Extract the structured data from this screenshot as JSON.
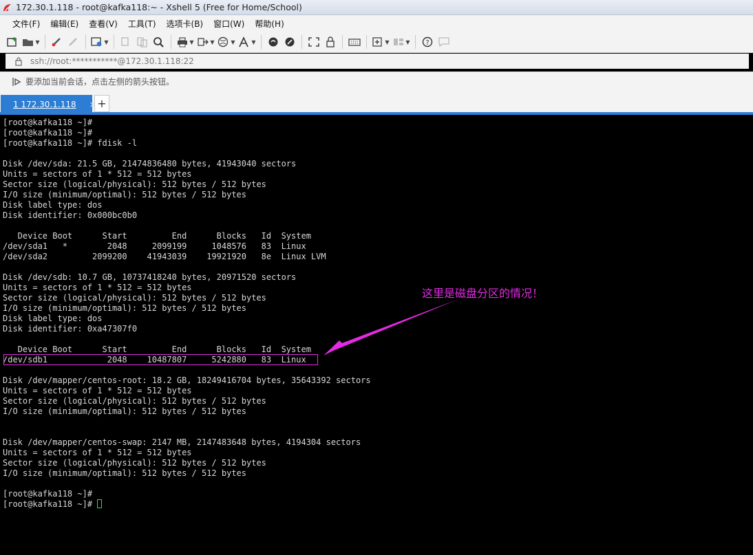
{
  "window": {
    "title": "172.30.1.118 - root@kafka118:~ - Xshell 5 (Free for Home/School)"
  },
  "menu": {
    "items": [
      "文件(F)",
      "编辑(E)",
      "查看(V)",
      "工具(T)",
      "选项卡(B)",
      "窗口(W)",
      "帮助(H)"
    ]
  },
  "toolbar": {
    "icons": [
      "new-session",
      "open-folder",
      "connect",
      "disconnect",
      "properties",
      "copy",
      "paste",
      "find",
      "print",
      "transfer",
      "globe",
      "font",
      "xftp",
      "xshell",
      "fullscreen",
      "lock",
      "keyboard",
      "add",
      "layout",
      "help",
      "chat"
    ]
  },
  "address": {
    "text": "ssh://root:***********@172.30.1.118:22"
  },
  "hint": {
    "text": "要添加当前会话，点击左侧的箭头按钮。"
  },
  "tabs": [
    {
      "label": "1 172.30.1.118",
      "close": "×"
    }
  ],
  "new_tab": "+",
  "terminal": {
    "lines": [
      "[root@kafka118 ~]#",
      "[root@kafka118 ~]#",
      "[root@kafka118 ~]# fdisk -l",
      "",
      "Disk /dev/sda: 21.5 GB, 21474836480 bytes, 41943040 sectors",
      "Units = sectors of 1 * 512 = 512 bytes",
      "Sector size (logical/physical): 512 bytes / 512 bytes",
      "I/O size (minimum/optimal): 512 bytes / 512 bytes",
      "Disk label type: dos",
      "Disk identifier: 0x000bc0b0",
      "",
      "   Device Boot      Start         End      Blocks   Id  System",
      "/dev/sda1   *        2048     2099199     1048576   83  Linux",
      "/dev/sda2         2099200    41943039    19921920   8e  Linux LVM",
      "",
      "Disk /dev/sdb: 10.7 GB, 10737418240 bytes, 20971520 sectors",
      "Units = sectors of 1 * 512 = 512 bytes",
      "Sector size (logical/physical): 512 bytes / 512 bytes",
      "I/O size (minimum/optimal): 512 bytes / 512 bytes",
      "Disk label type: dos",
      "Disk identifier: 0xa47307f0",
      "",
      "   Device Boot      Start         End      Blocks   Id  System",
      "/dev/sdb1            2048    10487807     5242880   83  Linux",
      "",
      "Disk /dev/mapper/centos-root: 18.2 GB, 18249416704 bytes, 35643392 sectors",
      "Units = sectors of 1 * 512 = 512 bytes",
      "Sector size (logical/physical): 512 bytes / 512 bytes",
      "I/O size (minimum/optimal): 512 bytes / 512 bytes",
      "",
      "",
      "Disk /dev/mapper/centos-swap: 2147 MB, 2147483648 bytes, 4194304 sectors",
      "Units = sectors of 1 * 512 = 512 bytes",
      "Sector size (logical/physical): 512 bytes / 512 bytes",
      "I/O size (minimum/optimal): 512 bytes / 512 bytes",
      "",
      "[root@kafka118 ~]#",
      "[root@kafka118 ~]# "
    ]
  },
  "annotation": {
    "text": "这里是磁盘分区的情况！",
    "color": "#e42be4"
  },
  "colors": {
    "accent": "#2c7dd3",
    "terminal_bg": "#000000",
    "terminal_fg": "#d8d8d8",
    "cursor": "#2ee02e"
  }
}
